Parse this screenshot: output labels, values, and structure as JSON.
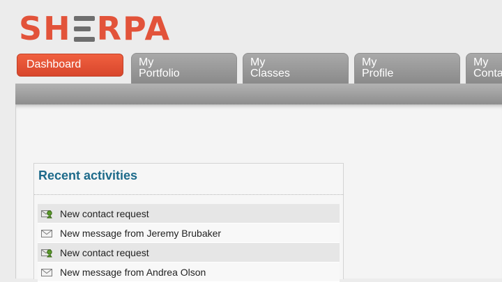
{
  "brand": {
    "logo_text": "SHERPA"
  },
  "tabs": [
    {
      "label_line1": "Dashboard",
      "label_line2": "",
      "active": true
    },
    {
      "label_line1": "My",
      "label_line2": "Portfolio",
      "active": false
    },
    {
      "label_line1": "My",
      "label_line2": "Classes",
      "active": false
    },
    {
      "label_line1": "My",
      "label_line2": "Profile",
      "active": false
    },
    {
      "label_line1": "My",
      "label_line2": "Conta",
      "active": false
    }
  ],
  "recent_activities": {
    "title": "Recent activities",
    "items": [
      {
        "text": "New contact request",
        "icon": "contact-request-icon"
      },
      {
        "text": "New message from Jeremy Brubaker",
        "icon": "envelope-icon"
      },
      {
        "text": "New contact request",
        "icon": "contact-request-icon"
      },
      {
        "text": "New message from Andrea Olson",
        "icon": "envelope-icon"
      }
    ]
  },
  "colors": {
    "brand_red": "#e2533a",
    "tab_gray": "#9a9a9a",
    "heading_blue": "#1d6a8a"
  }
}
